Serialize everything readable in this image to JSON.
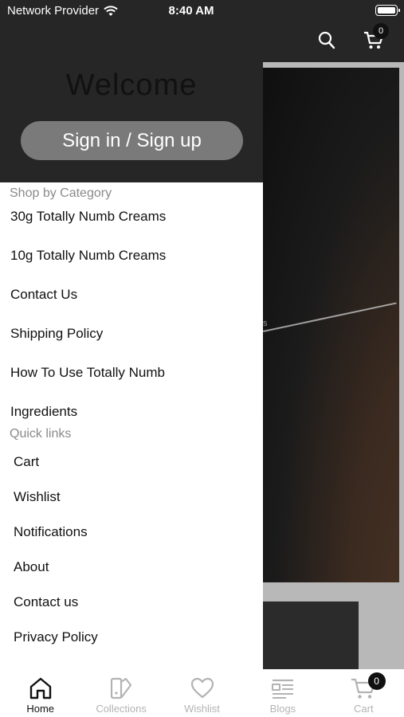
{
  "status_bar": {
    "carrier": "Network Provider",
    "time": "8:40 AM"
  },
  "header": {
    "cart_count": "0"
  },
  "hero": {
    "text": "s"
  },
  "drawer": {
    "welcome": "Welcome",
    "signin_label": "Sign in / Sign up",
    "category_title": "Shop by Category",
    "categories": [
      "30g Totally Numb Creams",
      "10g Totally Numb Creams",
      "Contact Us",
      "Shipping Policy",
      "How To Use Totally Numb",
      "Ingredients"
    ],
    "quicklinks_title": "Quick links",
    "quick_links": [
      "Cart",
      "Wishlist",
      "Notifications",
      "About",
      "Contact us",
      "Privacy Policy"
    ]
  },
  "tabbar": {
    "tabs": [
      {
        "label": "Home",
        "icon": "home-icon",
        "active": true
      },
      {
        "label": "Collections",
        "icon": "collections-icon",
        "active": false
      },
      {
        "label": "Wishlist",
        "icon": "heart-icon",
        "active": false
      },
      {
        "label": "Blogs",
        "icon": "blogs-icon",
        "active": false
      },
      {
        "label": "Cart",
        "icon": "cart-icon",
        "active": false
      }
    ],
    "cart_badge": "0"
  },
  "colors": {
    "drawer_header": "#262626",
    "signin_button": "#7a7a7a",
    "muted_text": "#8a8a8a",
    "inactive_tab": "#b3b3b3"
  }
}
